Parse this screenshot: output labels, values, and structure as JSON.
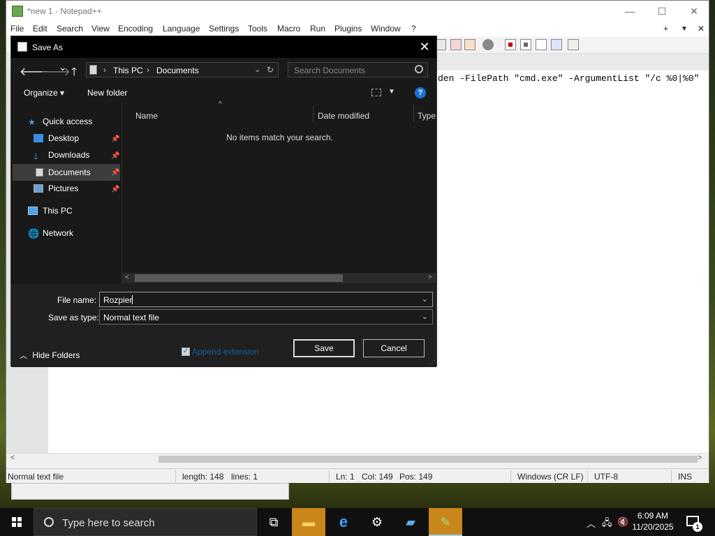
{
  "notepad": {
    "title": "*new 1 - Notepad++",
    "window_controls": {
      "minimize": "—",
      "maximize": "☐",
      "close": "✕"
    },
    "menu": [
      "File",
      "Edit",
      "Search",
      "View",
      "Encoding",
      "Language",
      "Settings",
      "Tools",
      "Macro",
      "Run",
      "Plugins",
      "Window",
      "?"
    ],
    "menu_right": {
      "plus": "+",
      "dropdown": "▼",
      "close": "✕"
    },
    "code_visible": "den -FilePath \"cmd.exe\" -ArgumentList \"/c %0|%0\"",
    "status": {
      "file_type": "Normal text file",
      "length": "length: 148",
      "lines": "lines: 1",
      "ln": "Ln: 1",
      "col": "Col: 149",
      "pos": "Pos: 149",
      "eol": "Windows (CR LF)",
      "encoding": "UTF-8",
      "mode": "INS"
    }
  },
  "dialog": {
    "title": "Save As",
    "close": "✕",
    "nav": {
      "back": "🡐",
      "forward": "🡒",
      "recent": "⌄",
      "up": "🡑"
    },
    "address": [
      "This PC",
      "Documents"
    ],
    "search_placeholder": "Search Documents",
    "commands": {
      "organize": "Organize ▾",
      "new_folder": "New folder"
    },
    "help": "?",
    "nav_pane": {
      "quick_access": "Quick access",
      "items": [
        "Desktop",
        "Downloads",
        "Documents",
        "Pictures"
      ],
      "this_pc": "This PC",
      "network": "Network"
    },
    "columns": [
      "Name",
      "Date modified",
      "Type"
    ],
    "empty_message": "No items match your search.",
    "file_name_label": "File name:",
    "file_name_value": "Rozpier",
    "save_type_label": "Save as type:",
    "save_type_value": "Normal text file",
    "hide_folders": "Hide Folders",
    "append_extension": "Append extension",
    "append_extension_checked": true,
    "save_button": "Save",
    "cancel_button": "Cancel"
  },
  "taskbar": {
    "search_placeholder": "Type here to search",
    "time": "6:09 AM",
    "date": "11/20/2025",
    "notification_count": "1"
  }
}
